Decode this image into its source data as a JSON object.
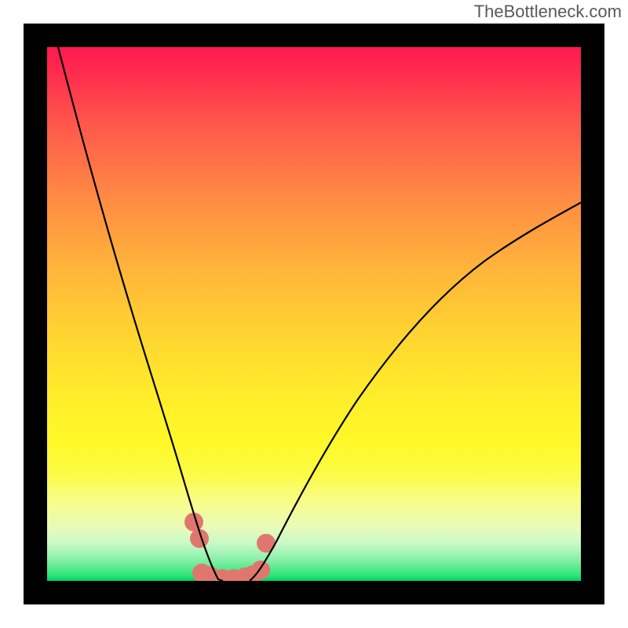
{
  "watermark": "TheBottleneck.com",
  "chart_data": {
    "type": "line",
    "title": "",
    "xlabel": "",
    "ylabel": "",
    "xlim": [
      0,
      100
    ],
    "ylim": [
      0,
      100
    ],
    "background": {
      "type": "vertical-gradient",
      "stops": [
        {
          "pos": 0,
          "color": "#ff1850",
          "meaning": "high-bottleneck"
        },
        {
          "pos": 50,
          "color": "#ffd030",
          "meaning": "medium-bottleneck"
        },
        {
          "pos": 100,
          "color": "#00cc66",
          "meaning": "no-bottleneck"
        }
      ]
    },
    "series": [
      {
        "name": "left-curve",
        "color": "#000000",
        "x": [
          2,
          5,
          8,
          11,
          14,
          17,
          20,
          23,
          26,
          28,
          30,
          31,
          32,
          33
        ],
        "y": [
          100,
          88,
          76,
          65,
          54,
          44,
          34,
          25,
          17,
          10,
          6,
          3,
          1,
          0
        ]
      },
      {
        "name": "right-curve",
        "color": "#000000",
        "x": [
          38,
          40,
          43,
          47,
          52,
          58,
          65,
          73,
          82,
          92,
          100
        ],
        "y": [
          0,
          2,
          6,
          13,
          22,
          32,
          42,
          51,
          59,
          66,
          71
        ]
      }
    ],
    "markers": {
      "color": "#e0776e",
      "points": [
        {
          "x": 27.5,
          "y": 11
        },
        {
          "x": 28.5,
          "y": 8
        },
        {
          "x": 29,
          "y": 1.5
        },
        {
          "x": 30.5,
          "y": 1
        },
        {
          "x": 33,
          "y": 0.5
        },
        {
          "x": 35,
          "y": 0.5
        },
        {
          "x": 37,
          "y": 0.8
        },
        {
          "x": 38.5,
          "y": 1.2
        },
        {
          "x": 40,
          "y": 2
        },
        {
          "x": 41,
          "y": 7
        }
      ],
      "radius": 12
    }
  }
}
